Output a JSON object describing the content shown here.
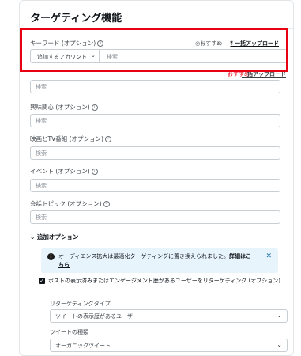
{
  "title": "ターゲティング機能",
  "keyword": {
    "label": "キーワード (オプション)",
    "recommend": "おすすめ",
    "bulk_upload": "一括アップロード",
    "select_value": "追加するアカウント",
    "placeholder": "検索"
  },
  "hidden_row": {
    "recommend": "おすすめ",
    "bulk_upload": "一括アップロード"
  },
  "fields": [
    {
      "label": "",
      "placeholder": "検索"
    },
    {
      "label": "興味関心 (オプション)",
      "placeholder": "検索"
    },
    {
      "label": "映画とTV番組 (オプション)",
      "placeholder": "検索"
    },
    {
      "label": "イベント (オプション)",
      "placeholder": "検索"
    },
    {
      "label": "会話トピック (オプション)",
      "placeholder": "検索"
    }
  ],
  "additional": {
    "label": "追加オプション",
    "notice": "オーディエンス拡大は最適化ターゲティングに置き換えられました。",
    "notice_link": "詳細はこちら",
    "checkbox_label": "ポストの表示済みまたはエンゲージメント歴があるユーザーをリターゲティング (オプション)",
    "retarget_type_label": "リターゲティングタイプ",
    "retarget_type_value": "ツイートの表示歴があるユーザー",
    "tweet_type_label": "ツイートの種類",
    "tweet_type_value": "オーガニックツイート"
  },
  "colors": {
    "highlight": "#e60012",
    "notice_bg": "#e8f4fb"
  }
}
